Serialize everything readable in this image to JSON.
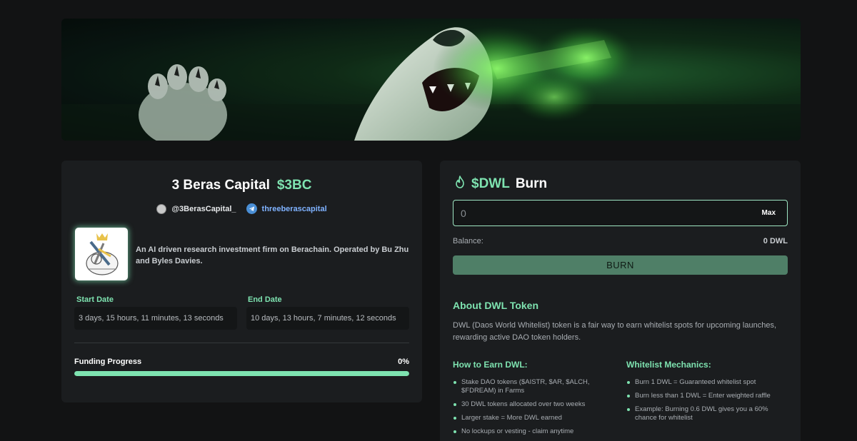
{
  "project": {
    "name": "3 Beras Capital",
    "ticker": "$3BC",
    "x_handle": "@3BerasCapital_",
    "telegram": "threeberascapital",
    "description": "An AI driven research investment firm on Berachain. Operated by Bu Zhu and Byles Davies."
  },
  "dates": {
    "start_label": "Start Date",
    "start_value": "3 days, 15 hours, 11 minutes, 13 seconds",
    "end_label": "End Date",
    "end_value": "10 days, 13 hours, 7 minutes, 12 seconds"
  },
  "funding": {
    "label": "Funding Progress",
    "percent_text": "0%",
    "progress_fraction": 0.0
  },
  "burn": {
    "token": "$DWL",
    "title": "Burn",
    "input_placeholder": "0",
    "max_label": "Max",
    "balance_label": "Balance:",
    "balance_value": "0 DWL",
    "button_label": "BURN"
  },
  "about": {
    "title": "About DWL Token",
    "text": "DWL (Daos World Whitelist) token is a fair way to earn whitelist spots for upcoming launches, rewarding active DAO token holders.",
    "earn_title": "How to Earn DWL:",
    "earn_items": [
      "Stake DAO tokens ($AISTR, $AR, $ALCH, $FDREAM) in Farms",
      "30 DWL tokens allocated over two weeks",
      "Larger stake = More DWL earned",
      "No lockups or vesting - claim anytime"
    ],
    "mech_title": "Whitelist Mechanics:",
    "mech_items": [
      "Burn 1 DWL = Guaranteed whitelist spot",
      "Burn less than 1 DWL = Enter weighted raffle",
      "Example: Burning 0.6 DWL gives you a 60% chance for whitelist"
    ]
  },
  "colors": {
    "accent": "#7ee3b0",
    "background": "#121314",
    "card": "#1b1d1f",
    "burn_button": "#4f7f67",
    "telegram": "#7fb2ff"
  },
  "icons": {
    "burn": "flame-icon",
    "telegram": "telegram-icon",
    "x_avatar": "avatar"
  }
}
